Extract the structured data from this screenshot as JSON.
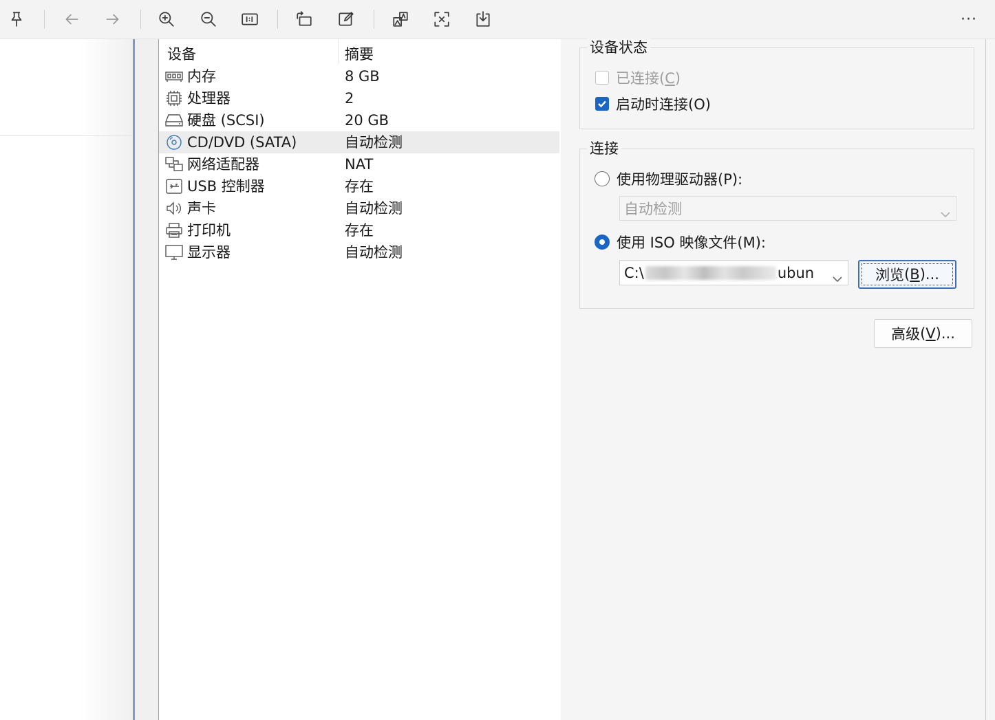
{
  "toolbar": {
    "buttons": [
      {
        "name": "pin-icon"
      },
      {
        "name": "back-icon"
      },
      {
        "name": "forward-icon"
      },
      {
        "name": "zoom-in-icon"
      },
      {
        "name": "zoom-out-icon"
      },
      {
        "name": "actual-size-icon"
      },
      {
        "name": "rotate-icon"
      },
      {
        "name": "edit-icon"
      },
      {
        "name": "visual-search-icon"
      },
      {
        "name": "crop-icon"
      },
      {
        "name": "save-icon"
      }
    ],
    "more_label": "···"
  },
  "device_list": {
    "col_device": "设备",
    "col_summary": "摘要",
    "rows": [
      {
        "icon": "memory-icon",
        "name": "内存",
        "summary": "8 GB"
      },
      {
        "icon": "processor-icon",
        "name": "处理器",
        "summary": "2"
      },
      {
        "icon": "hard-disk-icon",
        "name": "硬盘 (SCSI)",
        "summary": "20 GB"
      },
      {
        "icon": "cd-dvd-icon",
        "name": "CD/DVD (SATA)",
        "summary": "自动检测",
        "selected": true
      },
      {
        "icon": "network-adapter-icon",
        "name": "网络适配器",
        "summary": "NAT"
      },
      {
        "icon": "usb-controller-icon",
        "name": "USB 控制器",
        "summary": "存在"
      },
      {
        "icon": "sound-card-icon",
        "name": "声卡",
        "summary": "自动检测"
      },
      {
        "icon": "printer-icon",
        "name": "打印机",
        "summary": "存在"
      },
      {
        "icon": "display-icon",
        "name": "显示器",
        "summary": "自动检测"
      }
    ]
  },
  "device_status": {
    "legend": "设备状态",
    "connected_label": "已连接",
    "connected_key": "C",
    "connect_on_start_label": "启动时连接",
    "connect_on_start_key": "O"
  },
  "connection": {
    "legend": "连接",
    "physical_drive_label": "使用物理驱动器(P):",
    "physical_drive_value": "自动检测",
    "iso_label": "使用 ISO 映像文件(M):",
    "iso_path_prefix": "C:\\",
    "iso_path_suffix": "ubun",
    "browse_label": "浏览",
    "browse_key": "B",
    "browse_suffix": "..."
  },
  "advanced": {
    "label": "高级",
    "key": "V",
    "suffix": "..."
  },
  "colors": {
    "accent": "#1966c5",
    "selected_row": "#ececec"
  }
}
